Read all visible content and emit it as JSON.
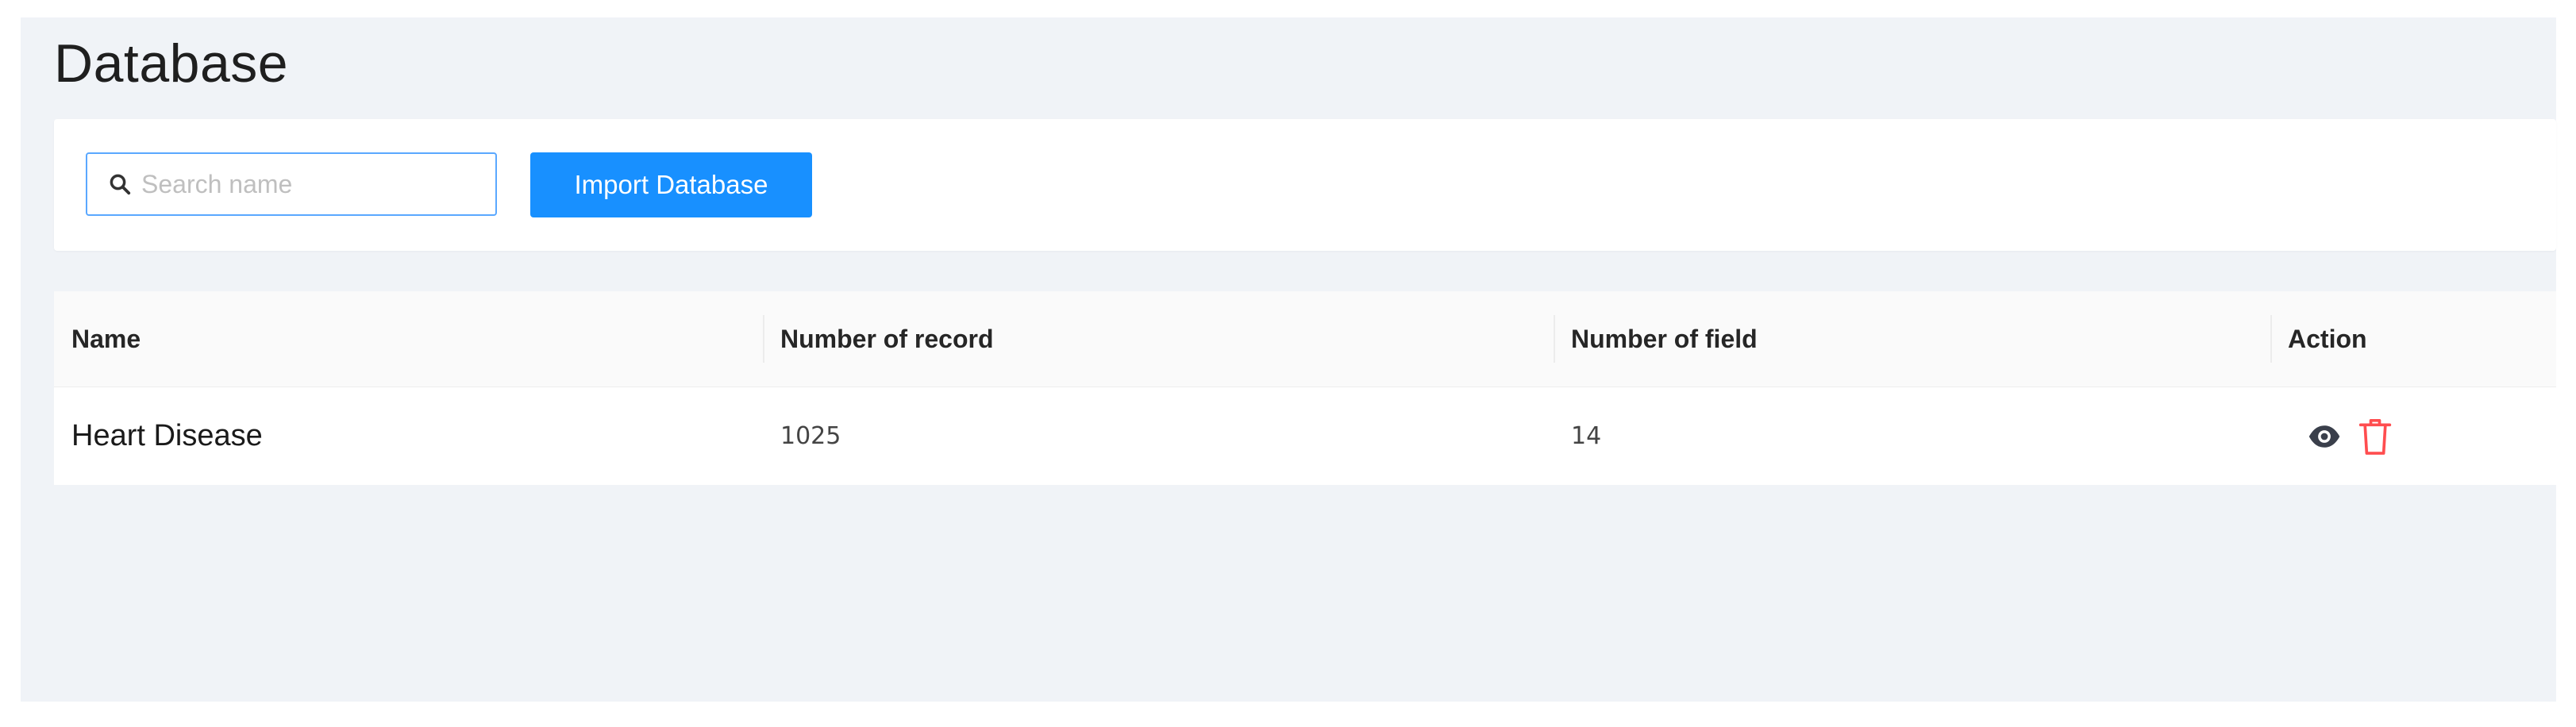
{
  "page": {
    "title": "Database"
  },
  "search": {
    "placeholder": "Search name",
    "value": ""
  },
  "toolbar": {
    "import_label": "Import Database"
  },
  "table": {
    "columns": [
      "Name",
      "Number of record",
      "Number of field",
      "Action"
    ],
    "rows": [
      {
        "name": "Heart Disease",
        "records": "1025",
        "fields": "14",
        "actions": [
          "eye-icon",
          "trash-icon"
        ]
      }
    ]
  },
  "colors": {
    "accent": "#1890ff",
    "danger": "#ff4d4f",
    "background": "#f0f3f7",
    "view_icon": "#3a3f4b"
  }
}
